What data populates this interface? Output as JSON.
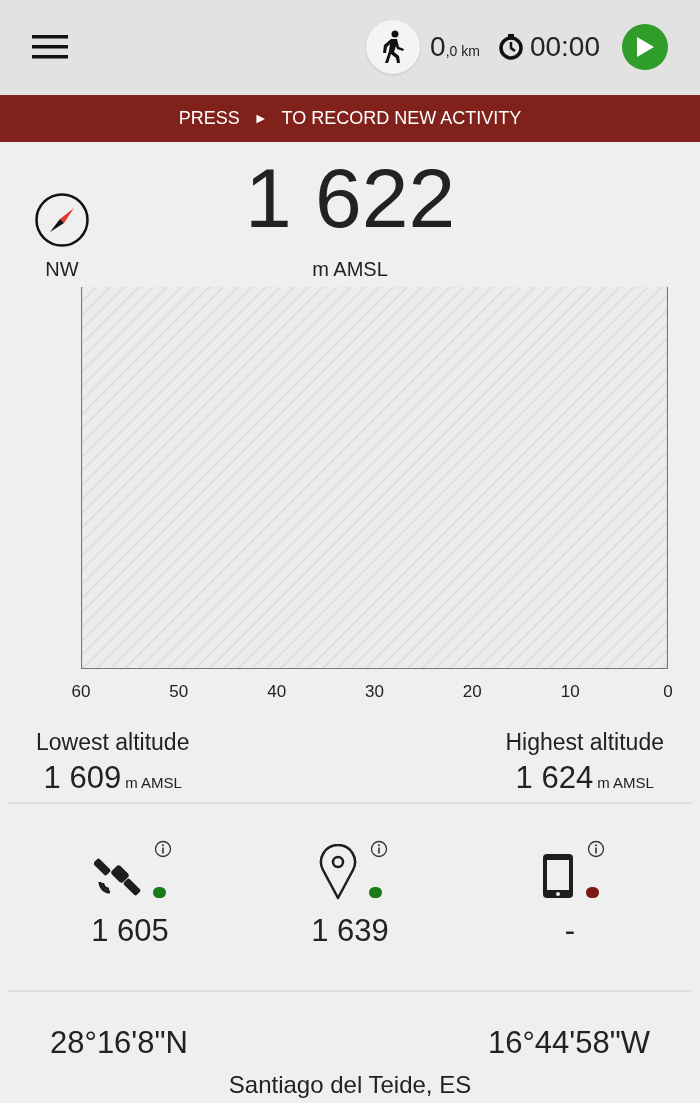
{
  "header": {
    "distance": {
      "value": "0",
      "unit": ",0 km"
    },
    "timer": "00:00"
  },
  "banner": {
    "before": "PRESS",
    "symbol": "►",
    "after": "TO RECORD NEW ACTIVITY"
  },
  "compass": {
    "direction": "NW"
  },
  "altitude": {
    "value": "1 622",
    "unit": "m AMSL"
  },
  "chart": {
    "x_axis_labels": [
      "60",
      "50",
      "40",
      "30",
      "20",
      "10",
      "0"
    ]
  },
  "extremes": [
    {
      "label": "Lowest altitude",
      "value": "1 609",
      "unit": "m AMSL"
    },
    {
      "label": "Highest altitude",
      "value": "1 624",
      "unit": "m AMSL"
    }
  ],
  "sources": [
    {
      "kind": "satellite",
      "color": "#1a7a1a",
      "value": "1 605"
    },
    {
      "kind": "pin",
      "color": "#1a7a1a",
      "value": "1 639"
    },
    {
      "kind": "phone",
      "color": "#7a1a12",
      "value": "-"
    }
  ],
  "location": {
    "latitude": "28°16'8\"N",
    "longitude": "16°44'58\"W",
    "place": "Santiago del Teide, ES"
  }
}
